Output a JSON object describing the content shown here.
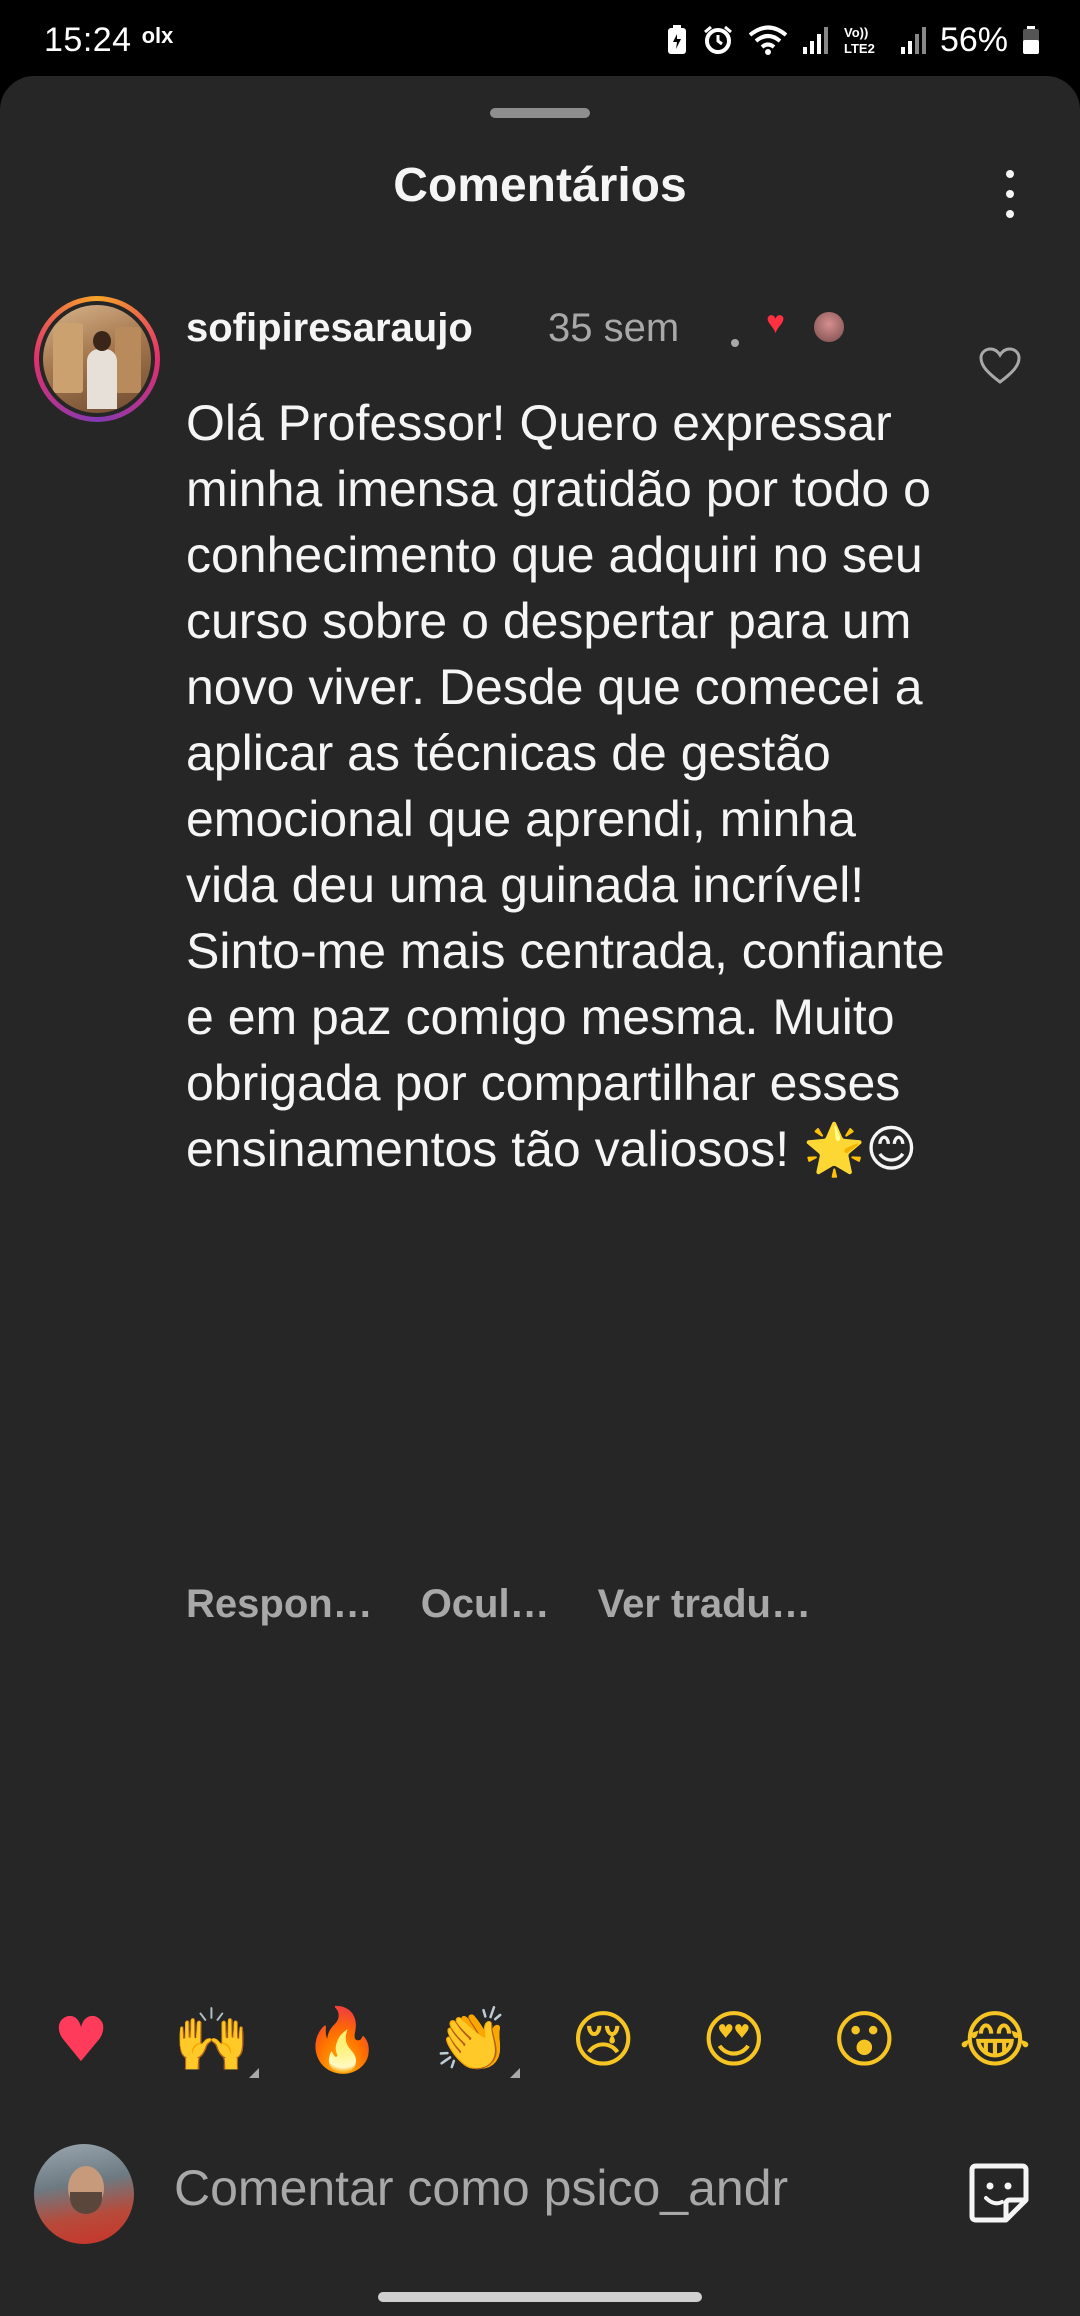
{
  "status_bar": {
    "time": "15:24",
    "app_badge": "olx",
    "network": "Vo)) LTE2",
    "battery_percent": "56%",
    "icons": [
      "battery-saver-icon",
      "alarm-icon",
      "wifi-icon",
      "signal-icon",
      "volte-icon",
      "signal-icon",
      "battery-icon"
    ]
  },
  "sheet": {
    "title": "Comentários"
  },
  "comment": {
    "username": "sofipiresaraujo",
    "time_ago": "35 sem",
    "text": "Olá Professor! Quero expressar minha imensa gratidão por todo o conhecimento que adquiri no seu curso sobre o despertar para um novo viver. Desde que comecei a aplicar as técnicas de gestão emocional que aprendi, minha vida deu uma guinada incrível! Sinto-me mais centrada, confiante e em paz comigo mesma. Muito obrigada por compartilhar esses ensinamentos tão valiosos! 🌟😊",
    "liked_by_creator": true,
    "actions": {
      "reply": "Respon…",
      "hide": "Ocul…",
      "translate": "Ver tradu…"
    }
  },
  "reactions": [
    {
      "name": "heart",
      "glyph": "♥"
    },
    {
      "name": "raised-hands",
      "glyph": "🙌"
    },
    {
      "name": "fire",
      "glyph": "🔥"
    },
    {
      "name": "clapping",
      "glyph": "👏"
    },
    {
      "name": "crying-face",
      "glyph": "😢"
    },
    {
      "name": "heart-eyes",
      "glyph": "😍"
    },
    {
      "name": "surprised-face",
      "glyph": "😮"
    },
    {
      "name": "tears-of-joy",
      "glyph": "😂"
    }
  ],
  "composer": {
    "placeholder": "Comentar como psico_andr"
  },
  "colors": {
    "sheet_bg": "#262626",
    "text_primary": "#f5f5f5",
    "text_secondary": "#a8a8a8",
    "like_red": "#ff3040"
  }
}
